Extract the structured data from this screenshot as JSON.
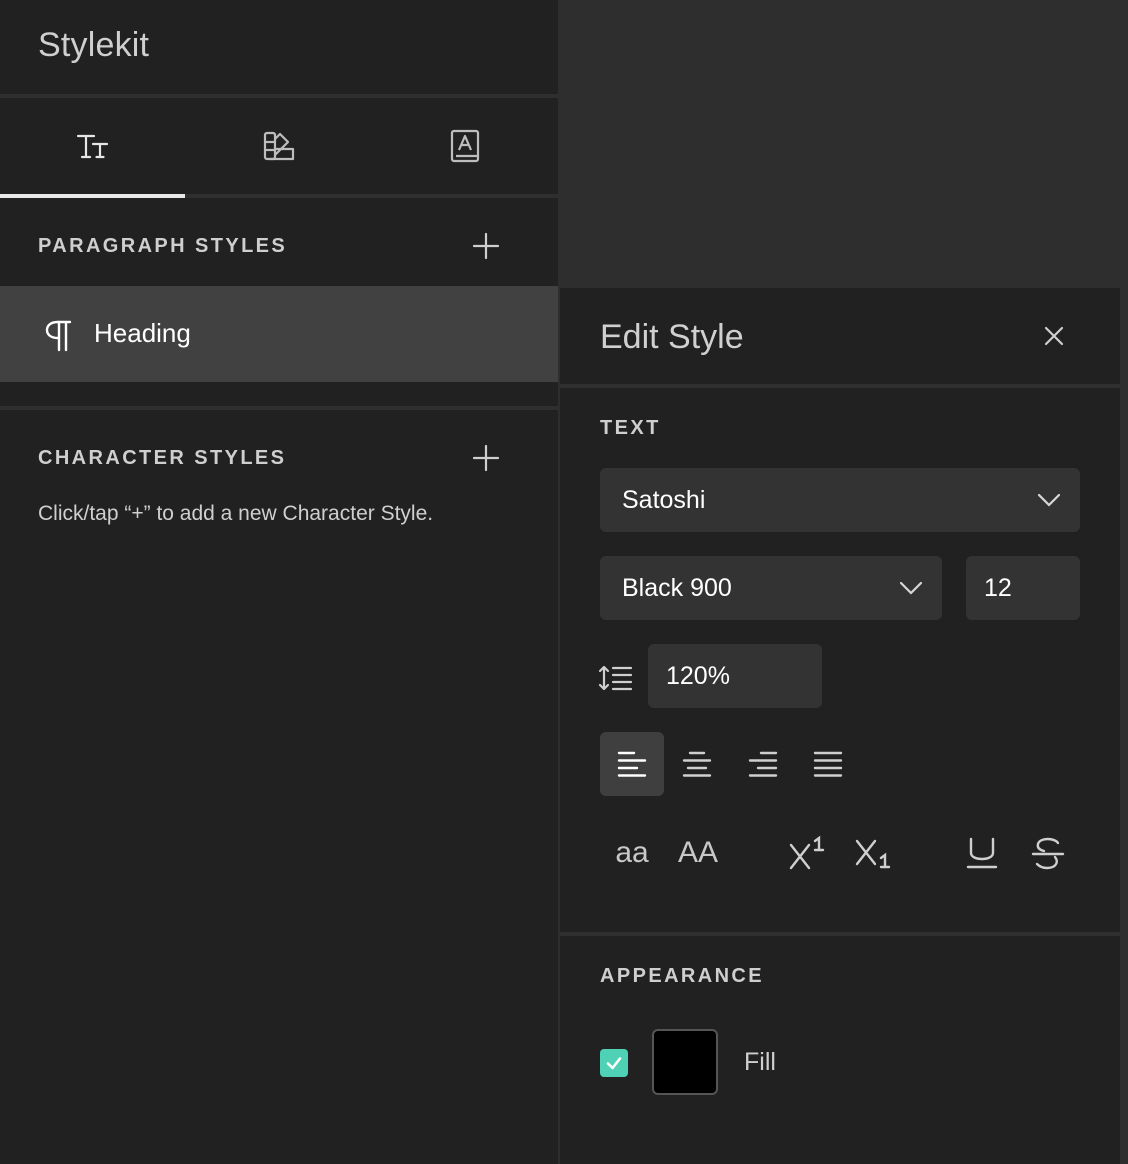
{
  "app": {
    "title": "Stylekit"
  },
  "tabs": [
    {
      "icon": "text-size-icon",
      "active": true
    },
    {
      "icon": "swatches-icon",
      "active": false
    },
    {
      "icon": "font-book-icon",
      "active": false
    }
  ],
  "paragraph_styles": {
    "title": "PARAGRAPH STYLES",
    "items": [
      {
        "label": "Heading",
        "icon": "pilcrow-icon"
      }
    ]
  },
  "character_styles": {
    "title": "CHARACTER STYLES",
    "hint": "Click/tap “+” to add a new Character Style."
  },
  "edit_style": {
    "title": "Edit Style",
    "text_section": "TEXT",
    "font_family": "Satoshi",
    "font_weight": "Black 900",
    "font_size": "12",
    "line_height": "120%",
    "alignment_options": [
      "align-left",
      "align-center",
      "align-right",
      "align-justify"
    ],
    "alignment_selected": "align-left",
    "case_options": {
      "lowercase": "aa",
      "uppercase": "AA"
    },
    "appearance_section": "APPEARANCE",
    "fill_label": "Fill",
    "fill_enabled": true,
    "fill_color": "#000000"
  },
  "colors": {
    "accent_checkbox": "#4fd1b5",
    "panel_bg": "#212121",
    "selected_row_bg": "#414141"
  }
}
